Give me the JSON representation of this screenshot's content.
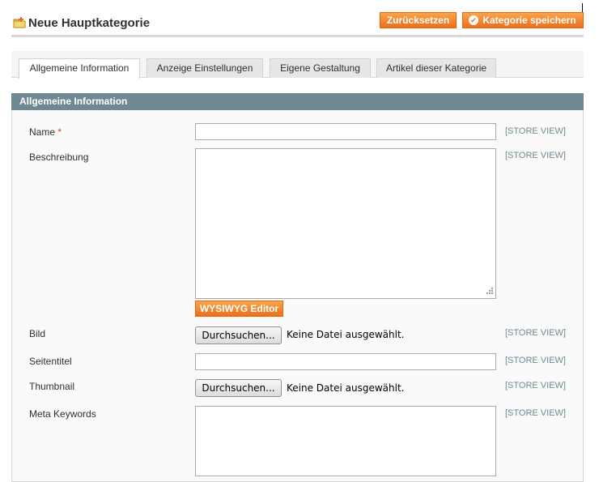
{
  "header": {
    "title": "Neue Hauptkategorie",
    "icon": "folder-add-icon",
    "buttons": {
      "reset_label": "Zurücksetzen",
      "save_label": "Kategorie speichern"
    }
  },
  "tabs": [
    {
      "label": "Allgemeine Information",
      "active": true
    },
    {
      "label": "Anzeige Einstellungen",
      "active": false
    },
    {
      "label": "Eigene Gestaltung",
      "active": false
    },
    {
      "label": "Artikel dieser Kategorie",
      "active": false
    }
  ],
  "section": {
    "title": "Allgemeine Information"
  },
  "form": {
    "required_marker": "*",
    "name": {
      "label": "Name",
      "value": "",
      "scope": "[STORE VIEW]"
    },
    "description": {
      "label": "Beschreibung",
      "value": "",
      "scope": "[STORE VIEW]",
      "editor_button": "WYSIWYG Editor"
    },
    "image": {
      "label": "Bild",
      "browse_label": "Durchsuchen...",
      "status": "Keine Datei ausgewählt.",
      "scope": "[STORE VIEW]"
    },
    "page_title": {
      "label": "Seitentitel",
      "value": "",
      "scope": "[STORE VIEW]"
    },
    "thumbnail": {
      "label": "Thumbnail",
      "browse_label": "Durchsuchen...",
      "status": "Keine Datei ausgewählt.",
      "scope": "[STORE VIEW]"
    },
    "meta_keywords": {
      "label": "Meta Keywords",
      "value": "",
      "scope": "[STORE VIEW]"
    }
  },
  "colors": {
    "accent": "#ee6d1c",
    "section_header": "#6f8992",
    "required": "#eb340a"
  }
}
